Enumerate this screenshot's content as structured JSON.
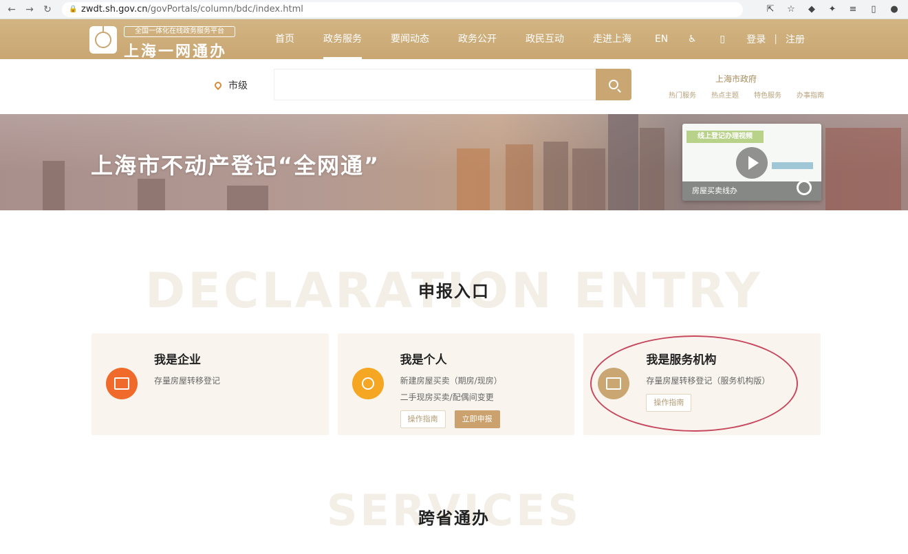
{
  "browser": {
    "url_host": "zwdt.sh.gov.cn",
    "url_path": "/govPortals/column/bdc/index.html"
  },
  "header": {
    "logo_subtitle": "全国一体化在线政务服务平台",
    "logo_title": "上海一网通办",
    "nav": [
      {
        "label": "首页",
        "active": false
      },
      {
        "label": "政务服务",
        "active": true
      },
      {
        "label": "要闻动态",
        "active": false
      },
      {
        "label": "政务公开",
        "active": false
      },
      {
        "label": "政民互动",
        "active": false
      },
      {
        "label": "走进上海",
        "active": false
      }
    ],
    "lang": "EN",
    "login": "登录",
    "separator": "|",
    "register": "注册"
  },
  "search": {
    "location": "市级",
    "placeholder": "",
    "hotline_title": "上海市政府",
    "hot_links": [
      "热门服务",
      "热点主题",
      "特色服务",
      "办事指南"
    ]
  },
  "banner": {
    "title": "上海市不动产登记“全网通”",
    "video_tag": "线上登记办理视频",
    "video_label": "房屋买卖线办"
  },
  "declaration": {
    "watermark": "DECLARATION ENTRY",
    "title": "申报入口",
    "cards": [
      {
        "title": "我是企业",
        "lines": [
          "存量房屋转移登记"
        ],
        "buttons": [],
        "icon_color": "#f06a2b"
      },
      {
        "title": "我是个人",
        "lines": [
          "新建房屋买卖（期房/现房）",
          "二手现房买卖/配偶间变更"
        ],
        "buttons": [
          {
            "label": "操作指南",
            "style": "outline"
          },
          {
            "label": "立即申报",
            "style": "filled"
          }
        ],
        "icon_color": "#f5a623"
      },
      {
        "title": "我是服务机构",
        "lines": [
          "存量房屋转移登记（服务机构版）"
        ],
        "buttons": [
          {
            "label": "操作指南",
            "style": "outline"
          }
        ],
        "icon_color": "#c9a672"
      }
    ]
  },
  "services": {
    "watermark": "SERVICES",
    "title": "跨省通办"
  }
}
